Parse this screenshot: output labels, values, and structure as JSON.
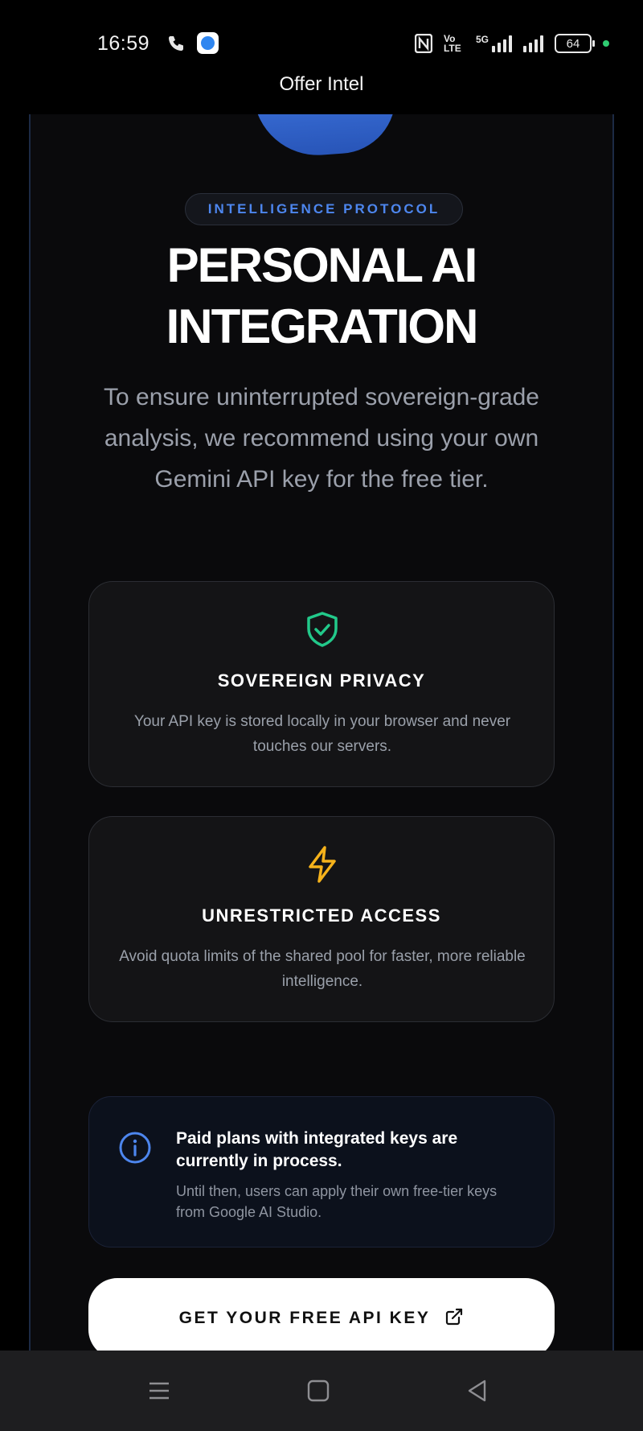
{
  "status_bar": {
    "time": "16:59",
    "signal_label": "5G",
    "volte_label": "Vo LTE",
    "battery_level": "64",
    "dot_color": "#2fcc71"
  },
  "app": {
    "title": "Offer Intel"
  },
  "hero": {
    "badge": "INTELLIGENCE PROTOCOL",
    "headline_line1": "PERSONAL AI",
    "headline_line2": "INTEGRATION",
    "description": "To ensure uninterrupted sovereign-grade analysis, we recommend using your own Gemini API key for the free tier."
  },
  "features": [
    {
      "icon": "shield-check-icon",
      "icon_color": "#22c98a",
      "title": "SOVEREIGN PRIVACY",
      "text": "Your API key is stored locally in your browser and never touches our servers."
    },
    {
      "icon": "lightning-bolt-icon",
      "icon_color": "#f5b21b",
      "title": "UNRESTRICTED ACCESS",
      "text": "Avoid quota limits of the shared pool for faster, more reliable intelligence."
    }
  ],
  "info": {
    "icon": "info-circle-icon",
    "icon_color": "#4d86ee",
    "title": "Paid plans with integrated keys are currently in process.",
    "text": "Until then, users can apply their own free-tier keys from Google AI Studio."
  },
  "cta": {
    "label": "GET YOUR FREE API KEY",
    "icon": "external-link-icon"
  },
  "colors": {
    "accent": "#4d86ee",
    "panel_bg": "#0a0a0c",
    "card_bg": "#141416"
  }
}
